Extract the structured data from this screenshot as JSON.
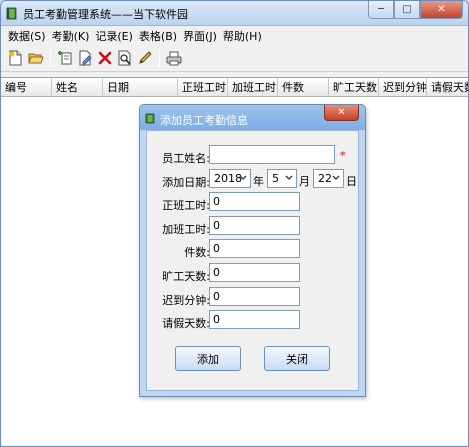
{
  "window": {
    "title": "员工考勤管理系统——当下软件园",
    "minimize": "─",
    "maximize": "□",
    "close": "✕"
  },
  "menu": [
    {
      "label": "数据(S)"
    },
    {
      "label": "考勤(K)"
    },
    {
      "label": "记录(E)"
    },
    {
      "label": "表格(B)"
    },
    {
      "label": "界面(J)"
    },
    {
      "label": "帮助(H)"
    }
  ],
  "toolbar": {
    "icons": [
      "new-doc-icon",
      "open-folder-icon",
      "add-record-icon",
      "edit-record-icon",
      "delete-icon",
      "search-icon",
      "pencil-icon",
      "print-icon"
    ]
  },
  "grid": {
    "columns": [
      "编号",
      "姓名",
      "日期",
      "正班工时",
      "加班工时",
      "件数",
      "旷工天数",
      "迟到分钟",
      "请假天数"
    ]
  },
  "dialog": {
    "title": "添加员工考勤信息",
    "close": "✕",
    "fields": {
      "name_label": "员工姓名:",
      "name_value": "",
      "required_mark": "*",
      "date_label": "添加日期:",
      "year": "2018",
      "year_unit": "年",
      "month": "5",
      "month_unit": "月",
      "day": "22",
      "day_unit": "日",
      "regular_hours_label": "正班工时:",
      "regular_hours": "0",
      "overtime_hours_label": "加班工时:",
      "overtime_hours": "0",
      "pieces_label": "件数:",
      "pieces": "0",
      "absent_days_label": "旷工天数:",
      "absent_days": "0",
      "late_minutes_label": "迟到分钟:",
      "late_minutes": "0",
      "leave_days_label": "请假天数:",
      "leave_days": "0"
    },
    "buttons": {
      "add": "添加",
      "close": "关闭"
    }
  }
}
